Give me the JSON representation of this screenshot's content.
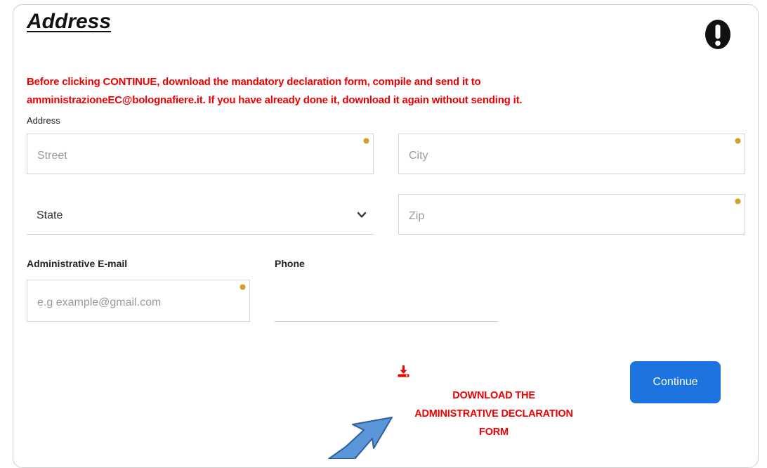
{
  "form": {
    "title": "Address",
    "notice_line1": "Before clicking CONTINUE, download the mandatory declaration form, compile and send it to",
    "notice_line2": "amministrazioneEC@bolognafiere.it. If you have already done it, download it again without sending it.",
    "address_label": "Address",
    "street_placeholder": "Street",
    "city_placeholder": "City",
    "state_value": "State",
    "zip_placeholder": "Zip",
    "email_label": "Administrative E-mail",
    "email_placeholder": "e.g example@gmail.com",
    "phone_label": "Phone",
    "phone_value": "",
    "download_line1": "DOWNLOAD THE",
    "download_line2": "ADMINISTRATIVE DECLARATION",
    "download_line3": "FORM",
    "continue_label": "Continue"
  },
  "icons": {
    "alert": "exclamation-icon",
    "required": "required-marker-icon",
    "chevron": "chevron-down-icon",
    "download": "download-icon",
    "annotation_arrow": "arrow-icon"
  },
  "colors": {
    "accent_red": "#ee0000",
    "button_blue": "#1d74e0",
    "required_marker": "#d4a02a",
    "arrow_blue": "#5b96d8"
  }
}
